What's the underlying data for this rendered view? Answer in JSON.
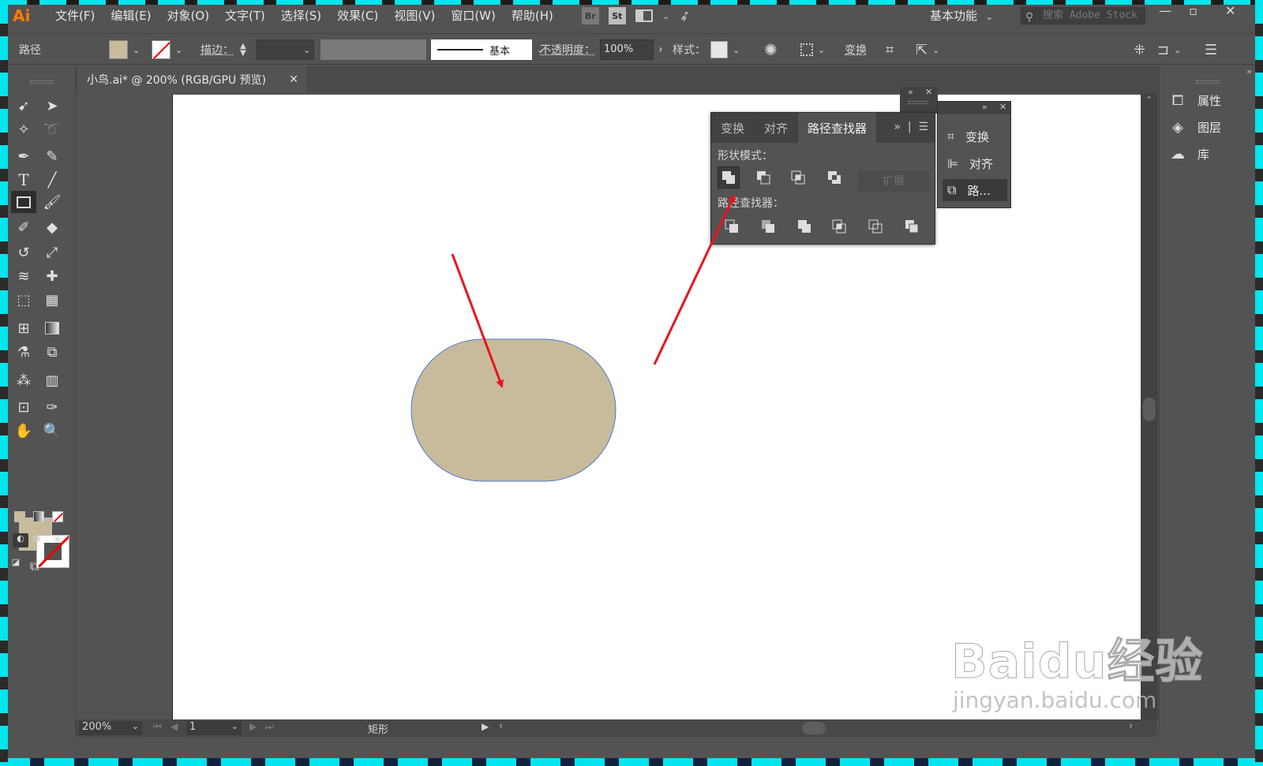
{
  "app": {
    "logo": "Ai",
    "workspace": "基本功能",
    "stock_search_placeholder": "搜索 Adobe Stock",
    "menu": [
      "文件(F)",
      "编辑(E)",
      "对象(O)",
      "文字(T)",
      "选择(S)",
      "效果(C)",
      "视图(V)",
      "窗口(W)",
      "帮助(H)"
    ],
    "bridge_label": "Br",
    "stock_label": "St"
  },
  "control_bar": {
    "selection_type": "路径",
    "fill_color": "#c8bb9b",
    "stroke_label": "描边：",
    "stroke_profile": "基本",
    "opacity_label": "不透明度：",
    "opacity_value": "100%",
    "style_label": "样式：",
    "transform_label": "变换"
  },
  "document": {
    "tab_title": "小鸟.ai* @ 200% (RGB/GPU 预览)",
    "shape_fill": "#c8bb9b",
    "shape_stroke": "#4a78d0"
  },
  "status_bar": {
    "zoom": "200%",
    "page": "1",
    "current_tool": "矩形"
  },
  "right_dock": {
    "items": [
      "属性",
      "图层",
      "库"
    ]
  },
  "pathfinder_panel": {
    "tabs": [
      "变换",
      "对齐",
      "路径查找器"
    ],
    "active_tab": "路径查找器",
    "shape_modes_label": "形状模式：",
    "pathfinders_label": "路径查找器：",
    "expand_label": "扩展"
  },
  "side_panel": {
    "items": [
      "变换",
      "对齐",
      "路..."
    ]
  },
  "annotation": {
    "arrow_color": "#e8141e"
  },
  "watermark": {
    "brand": "Baidu经验",
    "url": "jingyan.baidu.com"
  }
}
